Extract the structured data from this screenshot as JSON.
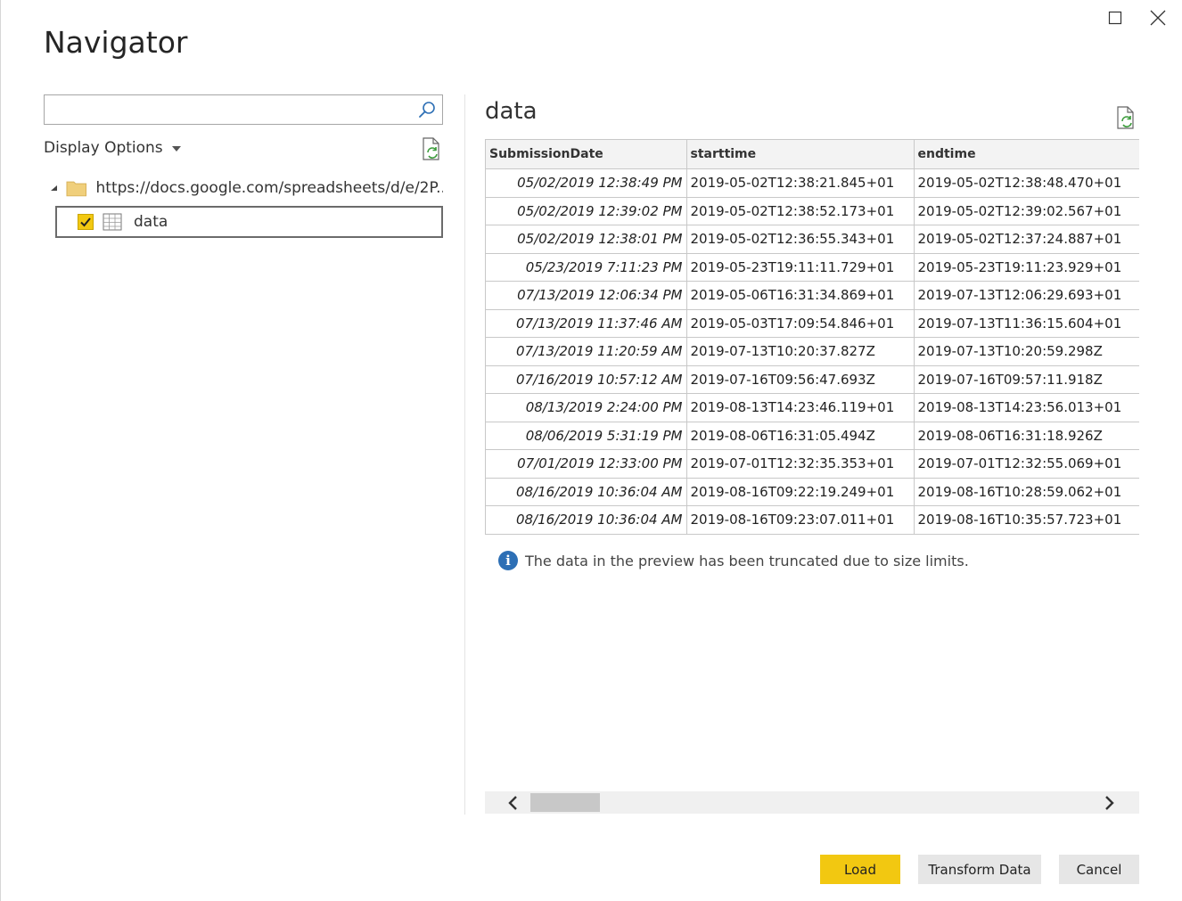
{
  "window": {
    "title": "Navigator"
  },
  "left": {
    "search": {
      "value": "",
      "placeholder": ""
    },
    "display_options_label": "Display Options",
    "tree": {
      "root_label": "https://docs.google.com/spreadsheets/d/e/2P...",
      "items": [
        {
          "label": "data",
          "checked": true
        }
      ]
    }
  },
  "preview": {
    "title": "data",
    "columns": [
      "SubmissionDate",
      "starttime",
      "endtime"
    ],
    "rows": [
      [
        "05/02/2019 12:38:49 PM",
        "2019-05-02T12:38:21.845+01",
        "2019-05-02T12:38:48.470+01"
      ],
      [
        "05/02/2019 12:39:02 PM",
        "2019-05-02T12:38:52.173+01",
        "2019-05-02T12:39:02.567+01"
      ],
      [
        "05/02/2019 12:38:01 PM",
        "2019-05-02T12:36:55.343+01",
        "2019-05-02T12:37:24.887+01"
      ],
      [
        "05/23/2019 7:11:23 PM",
        "2019-05-23T19:11:11.729+01",
        "2019-05-23T19:11:23.929+01"
      ],
      [
        "07/13/2019 12:06:34 PM",
        "2019-05-06T16:31:34.869+01",
        "2019-07-13T12:06:29.693+01"
      ],
      [
        "07/13/2019 11:37:46 AM",
        "2019-05-03T17:09:54.846+01",
        "2019-07-13T11:36:15.604+01"
      ],
      [
        "07/13/2019 11:20:59 AM",
        "2019-07-13T10:20:37.827Z",
        "2019-07-13T10:20:59.298Z"
      ],
      [
        "07/16/2019 10:57:12 AM",
        "2019-07-16T09:56:47.693Z",
        "2019-07-16T09:57:11.918Z"
      ],
      [
        "08/13/2019 2:24:00 PM",
        "2019-08-13T14:23:46.119+01",
        "2019-08-13T14:23:56.013+01"
      ],
      [
        "08/06/2019 5:31:19 PM",
        "2019-08-06T16:31:05.494Z",
        "2019-08-06T16:31:18.926Z"
      ],
      [
        "07/01/2019 12:33:00 PM",
        "2019-07-01T12:32:35.353+01",
        "2019-07-01T12:32:55.069+01"
      ],
      [
        "08/16/2019 10:36:04 AM",
        "2019-08-16T09:22:19.249+01",
        "2019-08-16T10:28:59.062+01"
      ],
      [
        "08/16/2019 10:36:04 AM",
        "2019-08-16T09:23:07.011+01",
        "2019-08-16T10:35:57.723+01"
      ]
    ],
    "info_text": "The data in the preview has been truncated due to size limits.",
    "info_icon": "info-icon"
  },
  "buttons": {
    "load": "Load",
    "transform": "Transform Data",
    "cancel": "Cancel"
  },
  "colors": {
    "accent": "#f2c811",
    "info": "#2d6fb5"
  }
}
